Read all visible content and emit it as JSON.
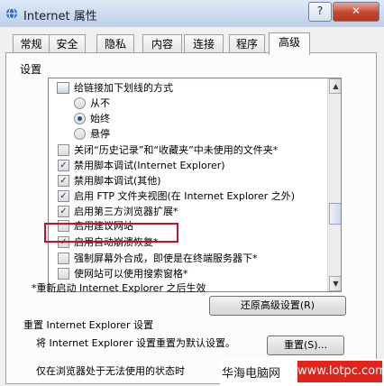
{
  "window": {
    "title": "Internet 属性",
    "help_glyph": "?",
    "close_glyph": "✕"
  },
  "tabs": [
    {
      "label": "常规"
    },
    {
      "label": "安全"
    },
    {
      "label": "隐私"
    },
    {
      "label": "内容"
    },
    {
      "label": "连接"
    },
    {
      "label": "程序"
    },
    {
      "label": "高级",
      "active": true
    }
  ],
  "settings": {
    "label": "设置",
    "items": [
      {
        "type": "group",
        "label": "给链接加下划线的方式"
      },
      {
        "type": "radio",
        "label": "从不",
        "checked": false
      },
      {
        "type": "radio",
        "label": "始终",
        "checked": true
      },
      {
        "type": "radio",
        "label": "悬停",
        "checked": false
      },
      {
        "type": "checkbox",
        "label": "关闭“历史记录”和“收藏夹”中未使用的文件夹*",
        "checked": false
      },
      {
        "type": "checkbox",
        "label": "禁用脚本调试(Internet Explorer)",
        "checked": true
      },
      {
        "type": "checkbox",
        "label": "禁用脚本调试(其他)",
        "checked": true
      },
      {
        "type": "checkbox",
        "label": "启用 FTP 文件夹视图(在 Internet Explorer 之外)",
        "checked": true
      },
      {
        "type": "checkbox",
        "label": "启用第三方浏览器扩展*",
        "checked": true
      },
      {
        "type": "checkbox",
        "label": "启用建议网站",
        "checked": false
      },
      {
        "type": "checkbox",
        "label": "启用自动崩溃恢复*",
        "checked": true,
        "highlighted": true
      },
      {
        "type": "checkbox",
        "label": "强制屏幕外合成，即使是在终端服务器下*",
        "checked": false
      },
      {
        "type": "checkbox",
        "label": "使网站可以使用搜索窗格*",
        "checked": false
      }
    ]
  },
  "note": "*重新启动 Internet Explorer 之后生效",
  "restore_button": "还原高级设置(R)",
  "reset": {
    "title": "重置 Internet Explorer 设置",
    "description": "将 Internet Explorer 设置重置为默认设置。",
    "button": "重置(S)...",
    "last_line": "仅在浏览器处于无法使用的状态时"
  },
  "watermark": {
    "text": "华海电脑网",
    "url": "www.lotpc.com"
  },
  "icons": {
    "scroll_up": "▲",
    "scroll_down": "▼",
    "check": "✓"
  }
}
